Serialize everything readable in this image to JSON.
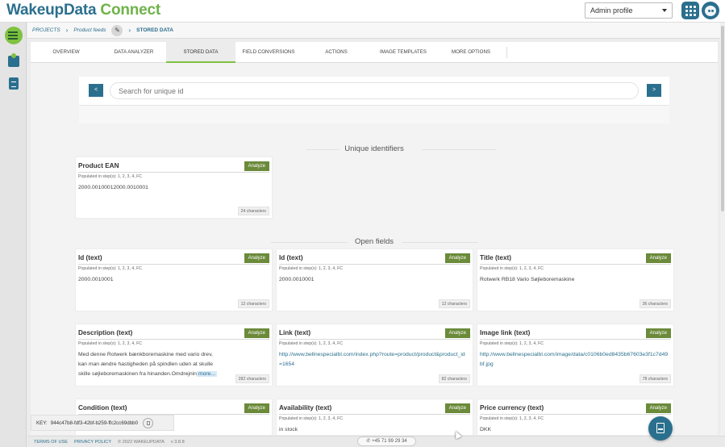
{
  "header": {
    "logo_part1": "WakeupData",
    "logo_part2": "Connect",
    "profile_select": "Admin profile"
  },
  "breadcrumb": {
    "projects": "PROJECTS",
    "product_feeds": "Product feeds",
    "current": "STORED DATA"
  },
  "tabs": [
    {
      "label": "OVERVIEW"
    },
    {
      "label": "DATA ANALYZER"
    },
    {
      "label": "STORED DATA"
    },
    {
      "label": "FIELD CONVERSIONS"
    },
    {
      "label": "ACTIONS"
    },
    {
      "label": "IMAGE TEMPLATES"
    },
    {
      "label": "MORE OPTIONS"
    }
  ],
  "search": {
    "placeholder": "Search for unique id",
    "prev": "<",
    "next": ">"
  },
  "sections": {
    "unique": "Unique identifiers",
    "open": "Open fields"
  },
  "cards": [
    {
      "title": "Product EAN",
      "analyze": "Analyze",
      "steps": "Populated in step(s): 1, 2, 3, 4, FC",
      "value": "2000.00100012000.0010001",
      "chars": "24 characters"
    },
    {
      "title": "Id (text)",
      "analyze": "Analyze",
      "steps": "Populated in step(s): 1, 2, 3, 4, FC",
      "value": "2000.0010001",
      "chars": "12 characters"
    },
    {
      "title": "Id (text)",
      "analyze": "Analyze",
      "steps": "Populated in step(s): 1, 2, 3, 4, FC",
      "value": "2000.0010001",
      "chars": "12 characters"
    },
    {
      "title": "Title (text)",
      "analyze": "Analyze",
      "steps": "Populated in step(s): 1, 2, 3, 4, FC",
      "value": "Rotwerk RB18 Vario Søjleboremaskine",
      "chars": "36 characters"
    },
    {
      "title": "Description (text)",
      "analyze": "Analyze",
      "steps": "Populated in step(s): 1, 2, 3, 4, FC",
      "value": "Med denne Rotwerk bænkboremaskine med vario drev, kan man ændre hastigheden på spindlen uden at skulle skille søjleboremaskinen fra hinanden.Omdrejnin",
      "more": "more...",
      "chars": "282 characters"
    },
    {
      "title": "Link (text)",
      "analyze": "Analyze",
      "steps": "Populated in step(s): 1, 2, 3, 4, FC",
      "value": "http://www.bellnespecialbl.com/index.php?route=product/product&product_id=1654",
      "chars": "82 characters"
    },
    {
      "title": "Image link (text)",
      "analyze": "Analyze",
      "steps": "Populated in step(s): 1, 2, 3, 4, FC",
      "value": "http://www.bellnespecialbl.com/image/data/c0106b0ed8435b67603e3f1c7d49bf.jpg",
      "chars": "78 characters"
    },
    {
      "title": "Condition (text)",
      "analyze": "Analyze",
      "steps": "",
      "value": "",
      "chars": ""
    },
    {
      "title": "Availability (text)",
      "analyze": "Analyze",
      "steps": "Populated in step(s): 1, 2, 3, 4, FC",
      "value": "in stock",
      "chars": ""
    },
    {
      "title": "Price currency (text)",
      "analyze": "Analyze",
      "steps": "Populated in step(s): 1, 2, 3, 4, FC",
      "value": "DKK",
      "chars": ""
    }
  ],
  "keybar": {
    "label": "KEY:",
    "value": "944c47b8-fdf3-42bf-b259-ffc2cc69dbb0"
  },
  "footer": {
    "terms": "TERMS OF USE",
    "privacy": "PRIVACY POLICY",
    "copyright": "© 2022 WAKEUPDATA",
    "version": "v 3.8.8",
    "phone": "+45 71 99 29 34"
  },
  "colors": {
    "brand_blue": "#2b6f8e",
    "brand_green": "#7fc241",
    "analyze_green": "#6b8a3a"
  }
}
